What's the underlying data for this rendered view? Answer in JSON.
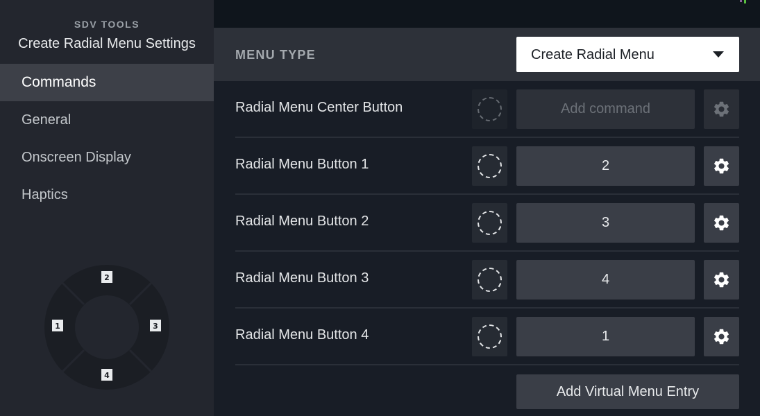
{
  "sidebar": {
    "app_label": "SDV TOOLS",
    "title": "Create Radial Menu Settings",
    "items": [
      {
        "label": "Commands",
        "active": true
      },
      {
        "label": "General",
        "active": false
      },
      {
        "label": "Onscreen Display",
        "active": false
      },
      {
        "label": "Haptics",
        "active": false
      }
    ],
    "radial_diagram": {
      "top": "2",
      "left": "1",
      "right": "3",
      "bottom": "4"
    }
  },
  "main": {
    "menu_type_label": "MENU TYPE",
    "menu_type_value": "Create Radial Menu",
    "rows": [
      {
        "label": "Radial Menu Center Button",
        "command": "Add command",
        "placeholder": true
      },
      {
        "label": "Radial Menu Button 1",
        "command": "2",
        "placeholder": false
      },
      {
        "label": "Radial Menu Button 2",
        "command": "3",
        "placeholder": false
      },
      {
        "label": "Radial Menu Button 3",
        "command": "4",
        "placeholder": false
      },
      {
        "label": "Radial Menu Button 4",
        "command": "1",
        "placeholder": false
      }
    ],
    "add_virtual_label": "Add Virtual Menu Entry"
  },
  "icons": {
    "slot": "dashed-circle-icon",
    "settings": "gear-icon",
    "dropdown": "caret-down-icon"
  },
  "colors": {
    "sidebar_bg": "#23262e",
    "active_item_bg": "#3d4048",
    "main_bg": "#181d26",
    "button_bg": "#3a3e47",
    "dropdown_bg": "#ffffff"
  }
}
